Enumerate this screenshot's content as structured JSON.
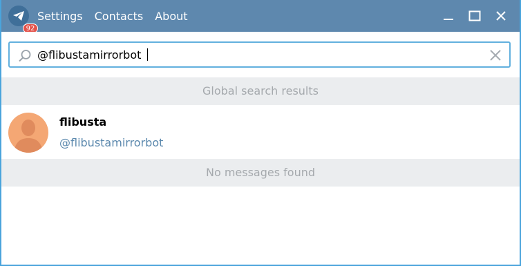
{
  "app": {
    "unread_badge": "92",
    "colors": {
      "titlebar": "#5e88ae",
      "accent": "#62b0de",
      "badge": "#e3524a",
      "avatar": "#f4a774"
    }
  },
  "menu": {
    "settings": "Settings",
    "contacts": "Contacts",
    "about": "About"
  },
  "window_controls": {
    "minimize": "minimize-icon",
    "maximize": "maximize-icon",
    "close": "close-icon"
  },
  "search": {
    "value": "@flibustamirrorbot",
    "placeholder": ""
  },
  "sections": {
    "global_results": "Global search results",
    "no_messages": "No messages found"
  },
  "results": [
    {
      "name": "flibusta",
      "username": "@flibustamirrorbot"
    }
  ]
}
